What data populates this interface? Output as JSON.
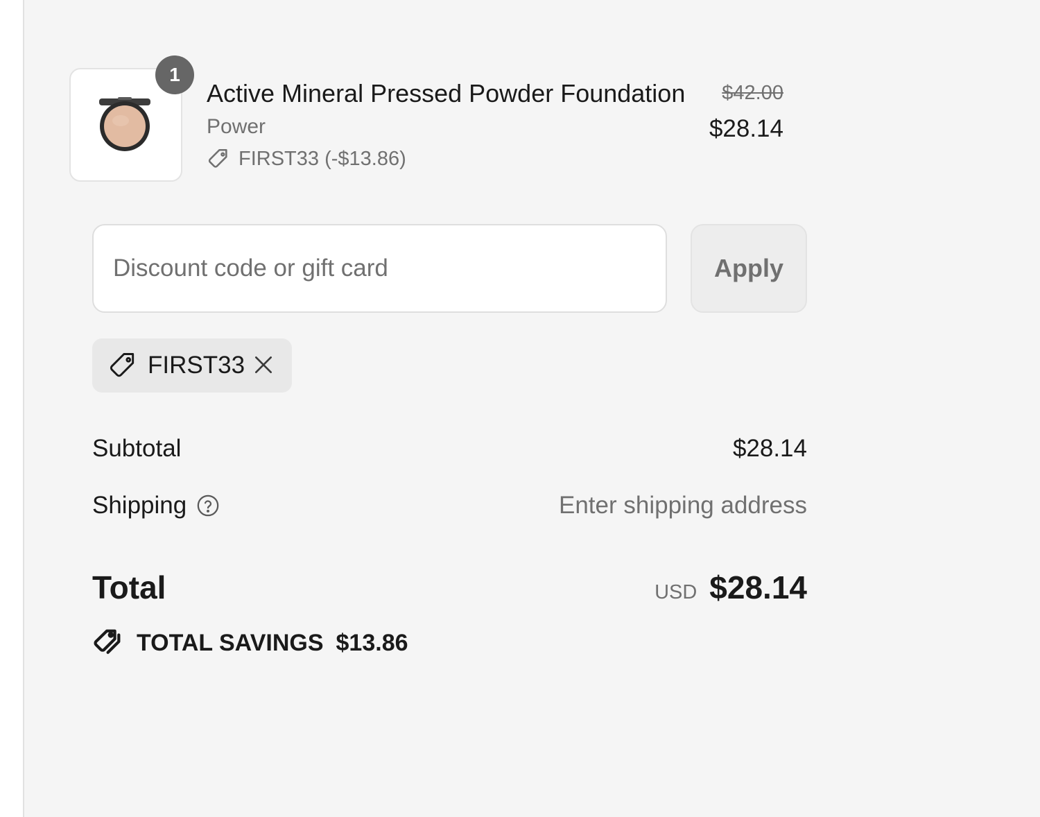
{
  "product": {
    "quantity": "1",
    "name": "Active Mineral Pressed Powder Foundation",
    "variant": "Power",
    "discount_line": "FIRST33 (-$13.86)",
    "original_price": "$42.00",
    "price": "$28.14"
  },
  "discount": {
    "placeholder": "Discount code or gift card",
    "apply_label": "Apply",
    "applied_code": "FIRST33"
  },
  "summary": {
    "subtotal_label": "Subtotal",
    "subtotal_value": "$28.14",
    "shipping_label": "Shipping",
    "shipping_value": "Enter shipping address",
    "total_label": "Total",
    "currency": "USD",
    "total_value": "$28.14",
    "savings_label": "TOTAL SAVINGS",
    "savings_value": "$13.86"
  },
  "colors": {
    "background": "#f5f5f5",
    "muted_text": "#707070",
    "badge": "#666666"
  },
  "icons": [
    "compact-powder-image",
    "tag-icon",
    "close-icon",
    "help-circle-icon",
    "savings-tag-icon"
  ]
}
